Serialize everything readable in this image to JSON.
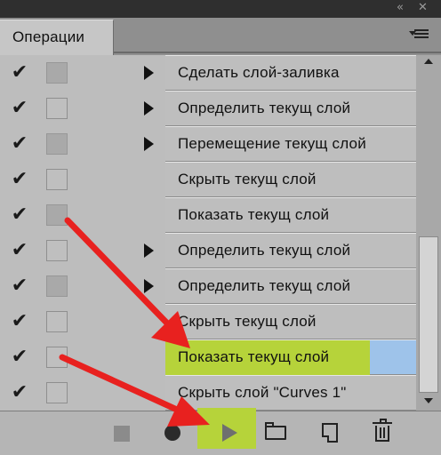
{
  "panel": {
    "tab_label": "Операции"
  },
  "actions": [
    {
      "check": "✔",
      "label": "Сделать слой-заливка",
      "expandable": true,
      "dialog_shade": "grey"
    },
    {
      "check": "✔",
      "label": "Определить текущ слой",
      "expandable": true,
      "dialog_shade": "light"
    },
    {
      "check": "✔",
      "label": "Перемещение текущ слой",
      "expandable": true,
      "dialog_shade": "grey"
    },
    {
      "check": "✔",
      "label": "Скрыть текущ слой",
      "expandable": false,
      "dialog_shade": "light"
    },
    {
      "check": "✔",
      "label": "Показать текущ слой",
      "expandable": false,
      "dialog_shade": "grey"
    },
    {
      "check": "✔",
      "label": "Определить текущ слой",
      "expandable": true,
      "dialog_shade": "light"
    },
    {
      "check": "✔",
      "label": "Определить текущ слой",
      "expandable": true,
      "dialog_shade": "grey"
    },
    {
      "check": "✔",
      "label": "Скрыть текущ слой",
      "expandable": false,
      "dialog_shade": "light"
    },
    {
      "check": "✔",
      "label": "Показать текущ слой",
      "expandable": false,
      "dialog_shade": "light",
      "selected": true,
      "highlighted": true
    },
    {
      "check": "✔",
      "label": "Скрыть слой \"Curves 1\"",
      "expandable": false,
      "dialog_shade": "light"
    }
  ],
  "toolbar": {
    "buttons": [
      "stop-icon",
      "record-icon",
      "play-icon",
      "folder-icon",
      "new-action-icon",
      "trash-icon"
    ]
  },
  "colors": {
    "highlight": "#b6d33a",
    "selection": "#9ec3ea",
    "arrow": "#e8211f"
  }
}
